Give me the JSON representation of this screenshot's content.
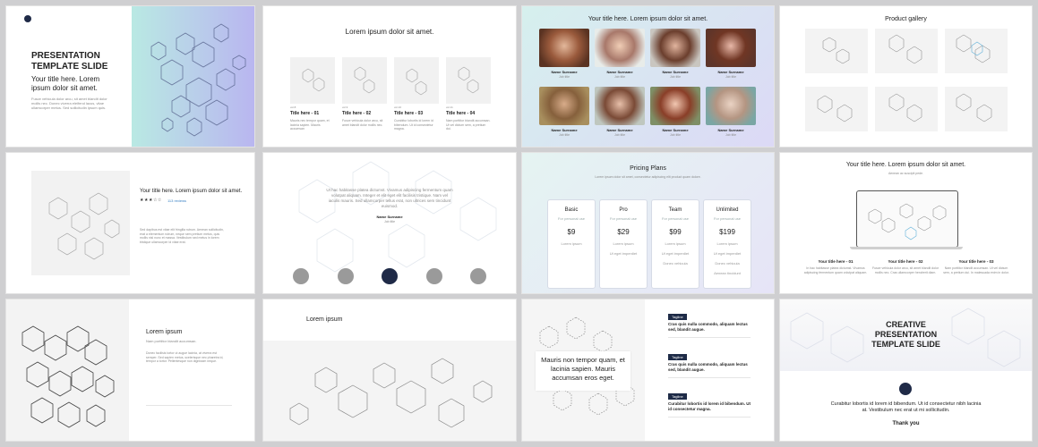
{
  "colors": {
    "background": "#cfcfd1",
    "navy": "#1f2a47",
    "gradient_start": "#b9e9e3",
    "gradient_end": "#b9b6f0"
  },
  "s1": {
    "title_line1": "PRESENTATION",
    "title_line2": "TEMPLATE SLIDE",
    "subtitle": "Your title here. Lorem ipsum dolor sit amet.",
    "body": "Fusce vehicula dolor arcu, sit amet blandit dolor mollis nec. Donec viverra eleifend lacus, vitae ullamcorper metus. Sed sollicitudin ipsum quis."
  },
  "s2": {
    "title": "Lorem ipsum dolor sit amet.",
    "items": [
      {
        "num": "vol.8",
        "title": "Title here - 01",
        "body": "Mauris nec tempor quam, et lacinia sapien. Mauris accumsan"
      },
      {
        "num": "vol.9",
        "title": "Title here - 02",
        "body": "Fusce vehicula dolor arcu, sit amet blandit dolor mollis nec."
      },
      {
        "num": "vol.10",
        "title": "Title here - 03",
        "body": "Curabitur lobortis id lorem id bibendum. Ut id consectetur magna."
      },
      {
        "num": "vol.11",
        "title": "Title here - 04",
        "body": "Nam porttitor blandit accumsan. Ut vel dictum sem, a pretium dui."
      }
    ]
  },
  "s3": {
    "title": "Your title here. Lorem ipsum dolor sit amet.",
    "people": [
      {
        "name": "Name Surname",
        "role": "Job title"
      },
      {
        "name": "Name Surname",
        "role": "Job title"
      },
      {
        "name": "Name Surname",
        "role": "Job title"
      },
      {
        "name": "Name Surname",
        "role": "Job title"
      },
      {
        "name": "Name Surname",
        "role": "Job title"
      },
      {
        "name": "Name Surname",
        "role": "Job title"
      },
      {
        "name": "Name Surname",
        "role": "Job title"
      },
      {
        "name": "Name Surname",
        "role": "Job title"
      }
    ]
  },
  "s4": {
    "title": "Product gallery"
  },
  "s5": {
    "title": "Your title here. Lorem ipsum dolor sit amet.",
    "rating_stars": "★★★☆☆",
    "rating": 3,
    "reviews": "113 reviews",
    "body": "Sed dapibus est vitae elit fringilla rutrum. Aenean sollicitudin, erat a elementum rutrum, neque sem pretium metus, quis mollis nisl nunc et massa. Vestibulum sed metus in lorem tristique ullamcorper id vitae erat."
  },
  "s6": {
    "quote": "Ut hac habitasse platea dictumst. Vivamus adipiscing fermentum quam volutpat aliquam. Integer et elit eget elit facilisis tristique. Nam vel iaculis mauris. Sed ullamcorper tellus erat, non ultrices sem tincidunt euismod.",
    "name": "Name Surname",
    "role": "Job title"
  },
  "s7": {
    "title": "Pricing Plans",
    "subtitle": "Lorem ipsum dolor sit amet, consectetur adipiscing elit product quam dolore.",
    "plans": [
      {
        "name": "Basic",
        "sub": "For personal use",
        "price": "$9",
        "lines": [
          "Lorem ipsum"
        ]
      },
      {
        "name": "Pro",
        "sub": "For personal use",
        "price": "$29",
        "lines": [
          "Lorem ipsum",
          "Ut eget imperdiet"
        ]
      },
      {
        "name": "Team",
        "sub": "For personal use",
        "price": "$99",
        "lines": [
          "Lorem ipsum",
          "Ut eget imperdiet",
          "Donec vehicula"
        ]
      },
      {
        "name": "Unlimited",
        "sub": "For personal use",
        "price": "$199",
        "lines": [
          "Lorem ipsum",
          "Ut eget imperdiet",
          "Donec vehicula",
          "Aenean tincidunt"
        ]
      }
    ]
  },
  "s8": {
    "title": "Your title here. Lorem ipsum dolor sit amet.",
    "subtitle": "Aenean ac suscipit pede.",
    "cols": [
      {
        "title": "Your title here - 01",
        "body": "In hac habitasse platea dictumst. Vivamus adipiscing fermentum quam volutpat aliquam."
      },
      {
        "title": "Your title here - 02",
        "body": "Fusce vehicula dolor arcu, sit amet blandit dolor mollis nec. Cras ullamcorper hendrerit diam."
      },
      {
        "title": "Your title here - 03",
        "body": "Nam porttitor blandit accumsan. Ut vel dictum sem, a pretium dui. In malesuada enim in dolor."
      }
    ]
  },
  "s9": {
    "title": "Lorem ipsum",
    "subtitle": "Nam porttitor blandit accumsan.",
    "body": "Donec facilisis tortor ut augue lacinia, at viverra est semper. Sed sapien metus, scelerisque nec pharetra id, tempor a tortor. Pellentesque non dignissim neque."
  },
  "s10": {
    "title": "Lorem ipsum"
  },
  "s11": {
    "quote": "Mauris non tempor quam, et lacinia sapien. Mauris accumsan eros eget.",
    "items": [
      {
        "tag": "Tagline",
        "text": "Cras quis nulla commodo, aliquam lectus sed, blandit augue."
      },
      {
        "tag": "Tagline",
        "text": "Cras quis nulla commodo, aliquam lectus sed, blandit augue."
      },
      {
        "tag": "Tagline",
        "text": "Curabitur lobortis id lorem id bibendum. Ut id consectetur magna."
      }
    ]
  },
  "s12": {
    "title_line1": "CREATIVE",
    "title_line2": "PRESENTATION",
    "title_line3": "TEMPLATE SLIDE",
    "body": "Curabitur lobortis id lorem id bibendum. Ut id consectetur nibh lacinia at. Vestibulum nec erat ut mi sollicitudin.",
    "thanks": "Thank you"
  }
}
